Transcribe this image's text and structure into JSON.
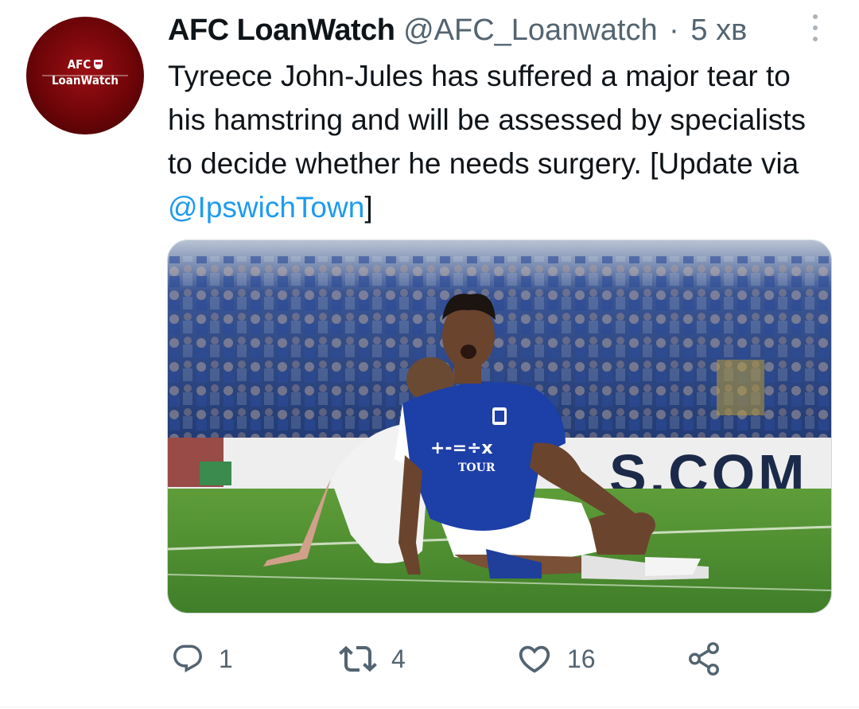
{
  "tweet": {
    "avatar_line1": "AFC",
    "avatar_line2": "LoanWatch",
    "display_name": "AFC LoanWatch",
    "handle": "@AFC_Loanwatch",
    "separator": "·",
    "time": "5 хв",
    "text_before": "Tyreece John-Jules has suffered a major tear to his hamstring and will be assessed by specialists to decide whether he needs surgery. [Update via ",
    "mention": "@IpswichTown",
    "text_after": "]",
    "media_shirt_text1": "+-=÷x",
    "media_shirt_text2": "TOUR",
    "media_board_text": "S.COM"
  },
  "actions": {
    "reply_count": "1",
    "retweet_count": "4",
    "like_count": "16"
  },
  "colors": {
    "text": "#0f1419",
    "secondary": "#536471",
    "link": "#1d9bf0",
    "avatar_red": "#8b0a10"
  },
  "icons": [
    "more-vertical-icon",
    "reply-icon",
    "retweet-icon",
    "like-icon",
    "share-icon"
  ]
}
